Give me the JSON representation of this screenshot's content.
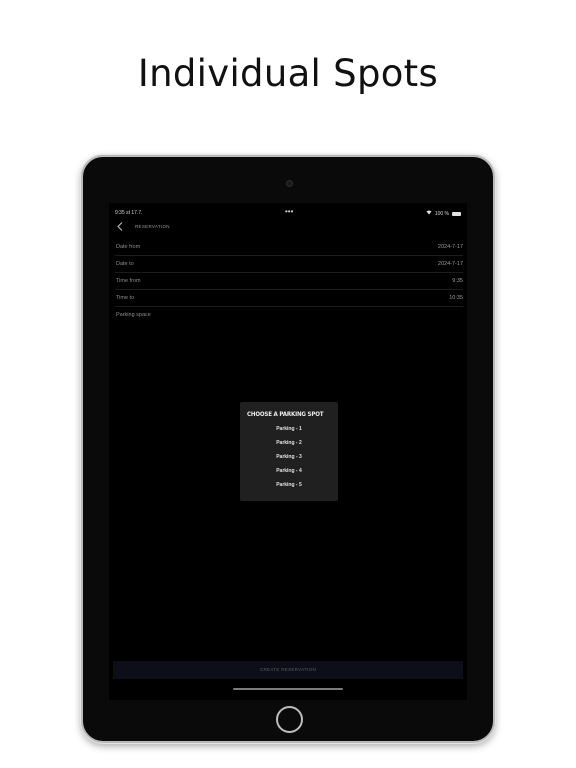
{
  "headline": "Individual Spots",
  "status_bar": {
    "time": "9:35   st 17.7.",
    "dots": "•••",
    "wifi_icon": "wifi-icon",
    "battery_text": "100 %",
    "battery_icon": "battery-icon"
  },
  "navbar": {
    "back_icon": "chevron-left-icon",
    "title": "RESERVATION"
  },
  "form": {
    "rows": [
      {
        "label": "Date from",
        "value": "2024-7-17"
      },
      {
        "label": "Date to",
        "value": "2024-7-17"
      },
      {
        "label": "Time from",
        "value": "9:35"
      },
      {
        "label": "Time to",
        "value": "10:35"
      },
      {
        "label": "Parking space",
        "value": ""
      }
    ]
  },
  "dialog": {
    "title": "CHOOSE A PARKING SPOT",
    "options": [
      "Parking - 1",
      "Parking - 2",
      "Parking - 3",
      "Parking - 4",
      "Parking - 5"
    ]
  },
  "create_button": "CREATE RESERVATION"
}
